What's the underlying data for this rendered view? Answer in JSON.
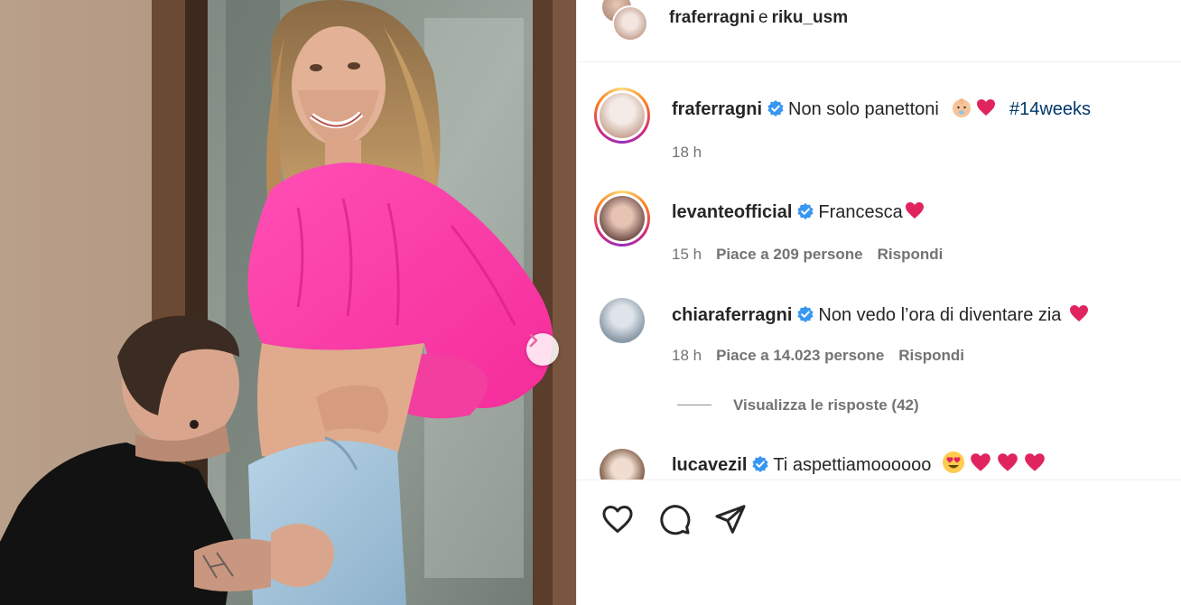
{
  "header": {
    "user1": "fraferragni",
    "conjunction": "e",
    "user2": "riku_usm"
  },
  "caption": {
    "username": "fraferragni",
    "text": "Non solo panettoni",
    "emojis": [
      "baby-emoji",
      "red-heart-emoji"
    ],
    "hashtag": "#14weeks",
    "time": "18 h"
  },
  "comments": [
    {
      "username": "levanteofficial",
      "text": "Francesca",
      "emojis": [
        "red-heart-emoji"
      ],
      "time": "15 h",
      "likes": "Piace a 209 persone",
      "reply": "Rispondi"
    },
    {
      "username": "chiaraferragni",
      "text": "Non vedo l’ora di diventare zia",
      "emojis": [
        "red-heart-emoji"
      ],
      "time": "18 h",
      "likes": "Piace a 14.023 persone",
      "reply": "Rispondi",
      "view_replies": "Visualizza le risposte (42)"
    },
    {
      "username": "lucavezil",
      "text": "Ti aspettiamoooooo",
      "emojis": [
        "heart-eyes-emoji",
        "red-heart-emoji",
        "red-heart-emoji",
        "red-heart-emoji"
      ]
    }
  ],
  "icons": {
    "like": "heart-outline-icon",
    "comment": "comment-bubble-icon",
    "share": "paper-plane-icon",
    "next": "chevron-right-icon",
    "verified": "verified-badge-icon"
  },
  "colors": {
    "verified": "#3897f0",
    "hashtag": "#00376b",
    "heart": "#e0245e",
    "chevron": "#e36aa0",
    "meta": "#737373"
  }
}
